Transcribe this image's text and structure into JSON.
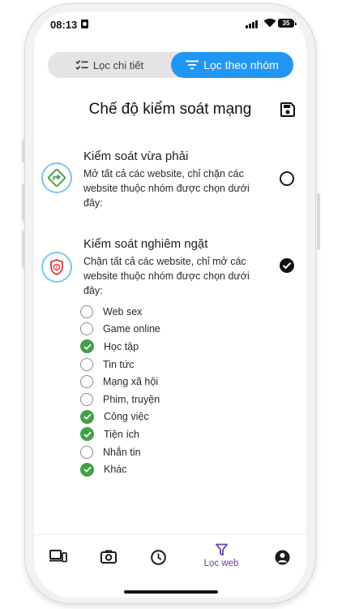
{
  "status_bar": {
    "time": "08:13",
    "battery": "35"
  },
  "filter_tabs": [
    {
      "label": "Lọc chi tiết",
      "icon": "checklist-icon",
      "active": false
    },
    {
      "label": "Lọc theo nhóm",
      "icon": "filter-lines-icon",
      "active": true
    }
  ],
  "page": {
    "title": "Chế độ kiểm soát mạng"
  },
  "modes": [
    {
      "title": "Kiểm soát vừa phải",
      "description": "Mở tất cả các website, chỉ chặn các website thuộc nhóm được chọn dưới đây:",
      "icon": "directions-sign-icon",
      "selected": false
    },
    {
      "title": "Kiểm soát nghiêm ngặt",
      "description": "Chặn tất cả các website, chỉ mở các website thuộc nhóm được chọn dưới đây:",
      "icon": "shield-alert-icon",
      "selected": true
    }
  ],
  "groups": [
    {
      "label": "Web sex",
      "checked": false
    },
    {
      "label": "Game online",
      "checked": false
    },
    {
      "label": "Học tập",
      "checked": true
    },
    {
      "label": "Tin tức",
      "checked": false
    },
    {
      "label": "Mạng xã hội",
      "checked": false
    },
    {
      "label": "Phim, truyện",
      "checked": false
    },
    {
      "label": "Công việc",
      "checked": true
    },
    {
      "label": "Tiện ích",
      "checked": true
    },
    {
      "label": "Nhắn tin",
      "checked": false
    },
    {
      "label": "Khác",
      "checked": true
    }
  ],
  "bottom_nav": [
    {
      "icon": "devices-icon",
      "label": "",
      "active": false
    },
    {
      "icon": "camera-icon",
      "label": "",
      "active": false
    },
    {
      "icon": "clock-icon",
      "label": "",
      "active": false
    },
    {
      "icon": "filter-icon",
      "label": "Lọc web",
      "active": true
    },
    {
      "icon": "account-icon",
      "label": "",
      "active": false
    }
  ],
  "colors": {
    "accent": "#2196f3",
    "check_green": "#43a047",
    "nav_active": "#6a3cb0",
    "tab_bg": "#e4e4e6"
  }
}
